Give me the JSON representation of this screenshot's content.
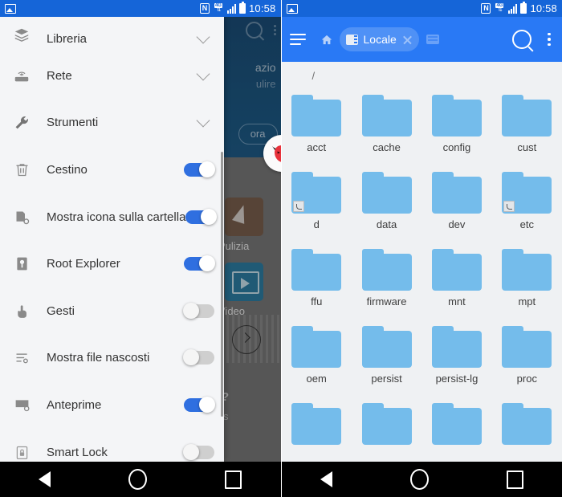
{
  "status_bar": {
    "photo_icon": "photo-icon",
    "nfc_label": "N",
    "network_label": "4G",
    "time": "10:58"
  },
  "left_phone": {
    "background_app": {
      "hero_text_1": "azio",
      "hero_text_2": "ulire",
      "hero_button": "ora",
      "tiles": [
        {
          "label": "Pulizia",
          "icon": "broom-icon"
        },
        {
          "label": "Video",
          "icon": "video-icon"
        }
      ],
      "help_mark": "?",
      "trailing_text": "s",
      "arrow_button_icon": "chevron-right-icon",
      "float_badge_icon": "devil-mask-icon"
    },
    "drawer": {
      "items": [
        {
          "label": "Libreria",
          "icon": "layers-icon",
          "control": "chevron",
          "state": ""
        },
        {
          "label": "Rete",
          "icon": "router-icon",
          "control": "chevron",
          "state": ""
        },
        {
          "label": "Strumenti",
          "icon": "wrench-icon",
          "control": "chevron",
          "state": ""
        },
        {
          "label": "Cestino",
          "icon": "trash-icon",
          "control": "switch",
          "state": "on"
        },
        {
          "label": "Mostra icona sulla cartella",
          "icon": "folder-badge-icon",
          "control": "switch",
          "state": "on"
        },
        {
          "label": "Root Explorer",
          "icon": "key-icon",
          "control": "switch",
          "state": "on"
        },
        {
          "label": "Gesti",
          "icon": "hand-tap-icon",
          "control": "switch",
          "state": "off"
        },
        {
          "label": "Mostra file nascosti",
          "icon": "list-settings-icon",
          "control": "switch",
          "state": "off"
        },
        {
          "label": "Anteprime",
          "icon": "image-settings-icon",
          "control": "switch",
          "state": "on"
        },
        {
          "label": "Smart Lock",
          "icon": "lock-icon",
          "control": "switch",
          "state": "off"
        }
      ]
    }
  },
  "right_phone": {
    "appbar": {
      "menu_icon": "hamburger-icon",
      "home_icon": "home-icon",
      "tab_label": "Locale",
      "tab_icon": "sdcard-icon",
      "tab_close_icon": "close-icon",
      "add_tab_icon": "add-tab-icon",
      "search_icon": "search-icon",
      "overflow_icon": "overflow-menu-icon"
    },
    "breadcrumb": "/",
    "folders": [
      {
        "name": "acct",
        "link": false
      },
      {
        "name": "cache",
        "link": false
      },
      {
        "name": "config",
        "link": false
      },
      {
        "name": "cust",
        "link": false
      },
      {
        "name": "d",
        "link": true
      },
      {
        "name": "data",
        "link": false
      },
      {
        "name": "dev",
        "link": false
      },
      {
        "name": "etc",
        "link": true
      },
      {
        "name": "ffu",
        "link": false
      },
      {
        "name": "firmware",
        "link": false
      },
      {
        "name": "mnt",
        "link": false
      },
      {
        "name": "mpt",
        "link": false
      },
      {
        "name": "oem",
        "link": false
      },
      {
        "name": "persist",
        "link": false
      },
      {
        "name": "persist-lg",
        "link": false
      },
      {
        "name": "proc",
        "link": false
      },
      {
        "name": "",
        "link": false
      },
      {
        "name": "",
        "link": false
      },
      {
        "name": "",
        "link": false
      },
      {
        "name": "",
        "link": false
      }
    ]
  },
  "nav_bar": {
    "back_icon": "back-triangle-icon",
    "home_icon": "home-circle-icon",
    "recents_icon": "recents-square-icon"
  },
  "colors": {
    "status_bar_left": "#1565d8",
    "app_bar": "#2979f5",
    "switch_on": "#2f6fe0",
    "switch_off": "#cfcfcf",
    "folder": "#74bceb",
    "file_bg": "#eff1f3"
  }
}
